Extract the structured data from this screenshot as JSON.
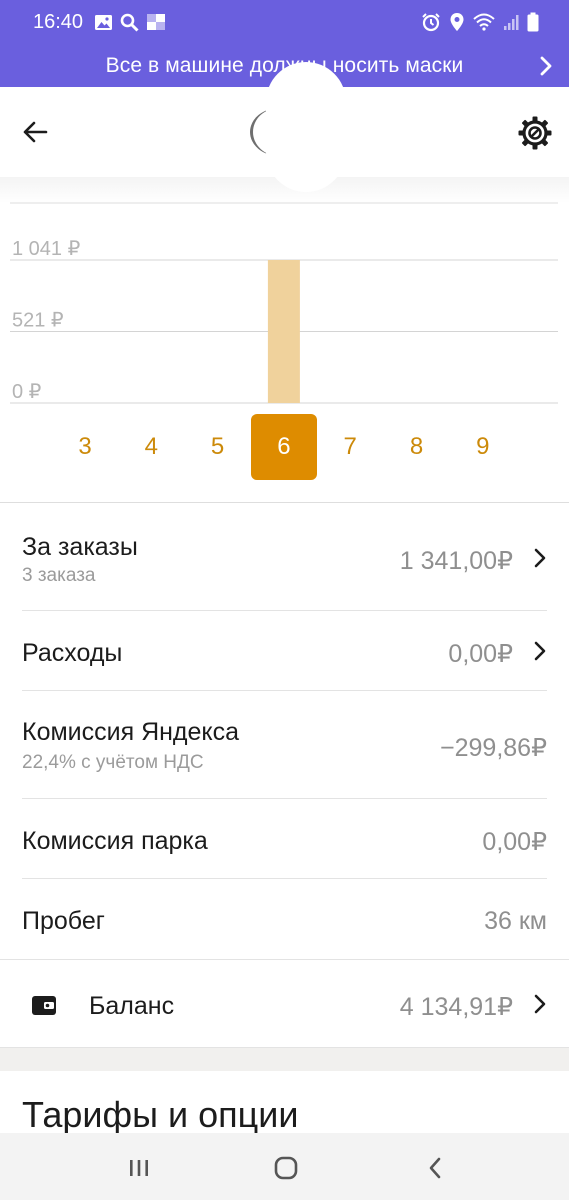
{
  "status_bar": {
    "time": "16:40",
    "left_icons": [
      "image-icon",
      "search-icon",
      "app-icon"
    ],
    "right_icons": [
      "alarm-icon",
      "location-icon",
      "wifi-icon",
      "signal-icon",
      "battery-icon"
    ]
  },
  "banner": {
    "text": "Все в машине должны носить маски",
    "color": "#6a5fde"
  },
  "header": {
    "back_icon": "arrow-left-icon",
    "settings_icon": "gear-icon"
  },
  "chart_data": {
    "type": "bar",
    "title": "",
    "xlabel": "",
    "ylabel": "",
    "y_ticks": [
      "1 041 ₽",
      "521 ₽",
      "0 ₽"
    ],
    "ylim": [
      0,
      1041
    ],
    "categories": [
      "3",
      "4",
      "5",
      "6",
      "7",
      "8",
      "9"
    ],
    "values": [
      0,
      0,
      0,
      1041,
      0,
      0,
      0
    ],
    "selected_category": "6",
    "bar_color": "#f0d29c",
    "selected_color": "#de8c00"
  },
  "rows": [
    {
      "title": "За заказы",
      "subtitle": "3 заказа",
      "value": "1 341,00₽",
      "chevron": true
    },
    {
      "title": "Расходы",
      "subtitle": "",
      "value": "0,00₽",
      "chevron": true
    },
    {
      "title": "Комиссия Яндекса",
      "subtitle": "22,4% с учётом НДС",
      "value": "−299,86₽",
      "chevron": false
    },
    {
      "title": "Комиссия парка",
      "subtitle": "",
      "value": "0,00₽",
      "chevron": false
    },
    {
      "title": "Пробег",
      "subtitle": "",
      "value": "36 км",
      "chevron": false
    }
  ],
  "balance": {
    "icon": "wallet-icon",
    "title": "Баланс",
    "value": "4 134,91₽"
  },
  "tariffs": {
    "title": "Тарифы и опции"
  },
  "nav_bar": {
    "icons": [
      "recent-apps-icon",
      "home-icon",
      "back-icon"
    ]
  }
}
